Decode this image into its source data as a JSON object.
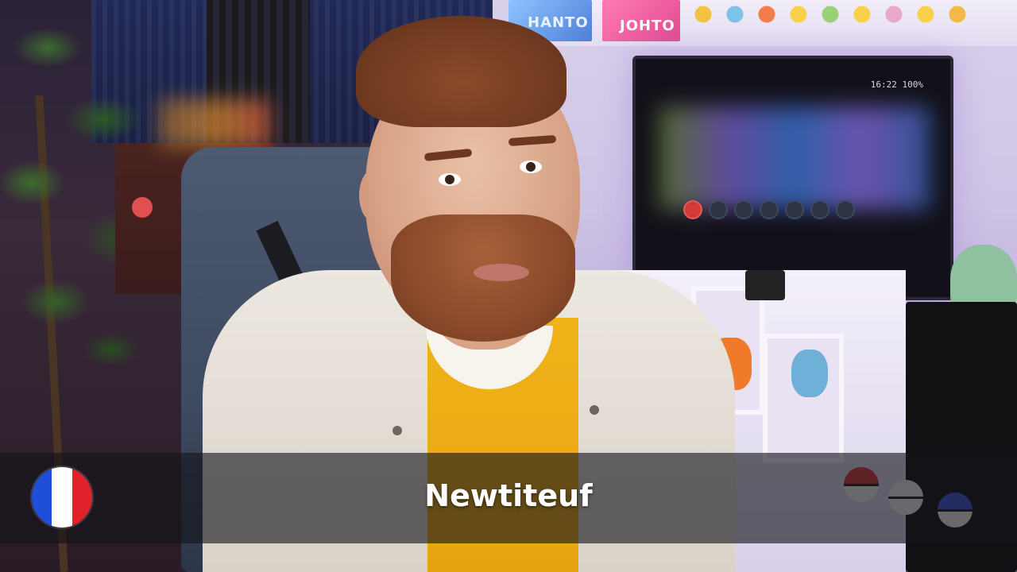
{
  "posters": {
    "poster_1": "HANTO",
    "poster_2": "JOHTO"
  },
  "tv": {
    "clock": "16:22   100%"
  },
  "caption": {
    "text": "Newtiteuf"
  },
  "flag": {
    "colors": [
      "#1f4fd8",
      "#ffffff",
      "#e0232b"
    ],
    "icon": "france-flag-icon"
  }
}
